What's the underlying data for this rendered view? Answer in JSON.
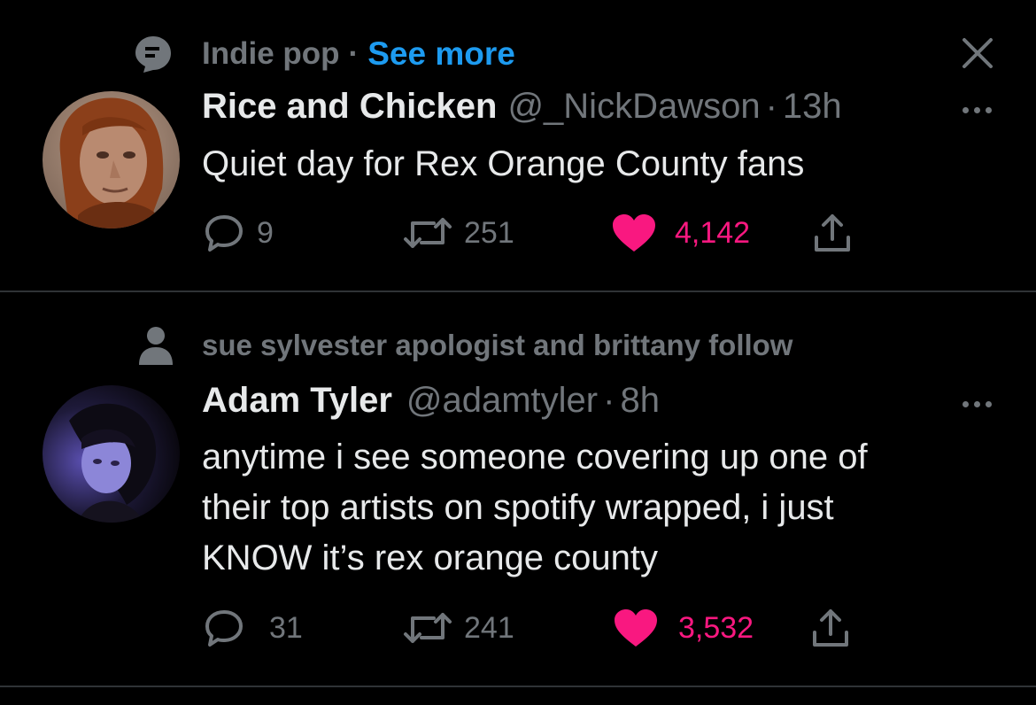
{
  "tweets": [
    {
      "context": {
        "topic": "Indie pop",
        "separator": "·",
        "link": "See more",
        "icon": "topic-icon"
      },
      "author": {
        "name": "Rice and Chicken",
        "handle": "@_NickDawson",
        "time": "13h"
      },
      "text": "Quiet day for Rex Orange County fans",
      "actions": {
        "replies": "9",
        "retweets": "251",
        "likes": "4,142",
        "liked": true
      },
      "icons": [
        "reply-icon",
        "retweet-icon",
        "heart-icon",
        "share-icon",
        "more-icon",
        "close-icon"
      ]
    },
    {
      "context": {
        "text": "sue sylvester apologist and brittany follow",
        "icon": "person-icon"
      },
      "author": {
        "name": "Adam Tyler",
        "handle": "@adamtyler",
        "time": "8h"
      },
      "text": "anytime i see someone covering up one of\ntheir top artists on spotify wrapped, i just\nKNOW it’s rex orange county",
      "actions": {
        "replies": "31",
        "retweets": "241",
        "likes": "3,532",
        "liked": true
      },
      "icons": [
        "reply-icon",
        "retweet-icon",
        "heart-icon",
        "share-icon",
        "more-icon"
      ]
    }
  ],
  "colors": {
    "background": "#000000",
    "text": "#e7e9ea",
    "muted": "#71767b",
    "link": "#1d9bf0",
    "like": "#f91880",
    "divider": "#2f3336"
  }
}
